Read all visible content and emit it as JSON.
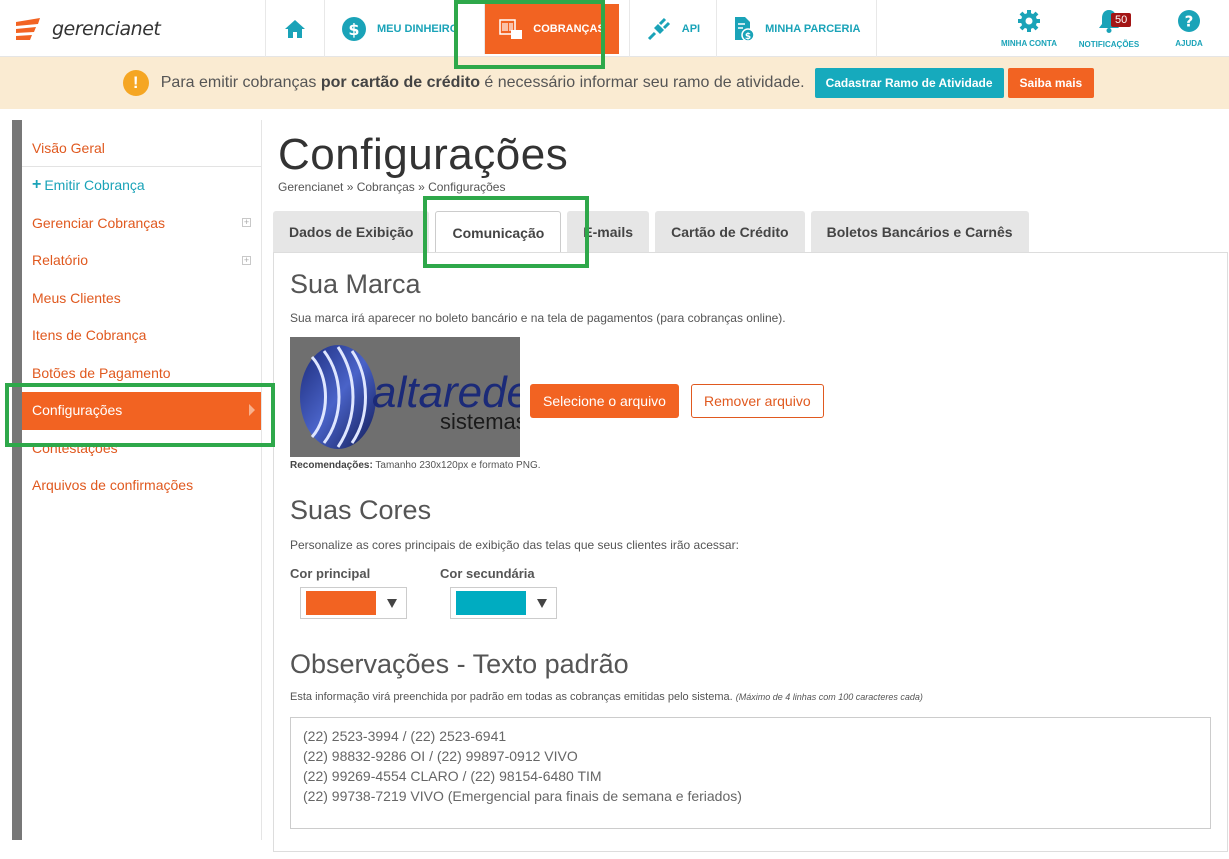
{
  "brand": {
    "name": "gerencianet"
  },
  "nav": {
    "items": [
      {
        "label": "",
        "icon": "home-icon"
      },
      {
        "label": "MEU DINHEIRO",
        "icon": "dollar-icon"
      },
      {
        "label": "COBRANÇAS",
        "icon": "billing-icon"
      },
      {
        "label": "API",
        "icon": "plug-icon"
      },
      {
        "label": "MINHA PARCERIA",
        "icon": "document-money-icon"
      }
    ],
    "right": {
      "account": "MINHA CONTA",
      "notifications": "NOTIFICAÇÕES",
      "notifications_count": "50",
      "help": "AJUDA"
    }
  },
  "alert": {
    "prefix": "Para emitir cobranças ",
    "bold": "por cartão de crédito",
    "suffix": " é necessário informar seu ramo de atividade.",
    "btn_primary": "Cadastrar Ramo de Atividade",
    "btn_secondary": "Saiba mais"
  },
  "sidebar": {
    "items": [
      {
        "label": "Visão Geral"
      },
      {
        "label": "Emitir Cobrança"
      },
      {
        "label": "Gerenciar Cobranças"
      },
      {
        "label": "Relatório"
      },
      {
        "label": "Meus Clientes"
      },
      {
        "label": "Itens de Cobrança"
      },
      {
        "label": "Botões de Pagamento"
      },
      {
        "label": "Configurações"
      },
      {
        "label": "Contestações"
      },
      {
        "label": "Arquivos de confirmações"
      }
    ]
  },
  "page": {
    "title": "Configurações",
    "breadcrumb": "Gerencianet » Cobranças » Configurações"
  },
  "tabs": [
    {
      "label": "Dados de Exibição"
    },
    {
      "label": "Comunicação"
    },
    {
      "label": "E-mails"
    },
    {
      "label": "Cartão de Crédito"
    },
    {
      "label": "Boletos Bancários e Carnês"
    }
  ],
  "brand_section": {
    "title": "Sua Marca",
    "desc": "Sua marca irá aparecer no boleto bancário e na tela de pagamentos (para cobranças online).",
    "logo_word": "altarede",
    "logo_sub": "sistemas",
    "btn_select": "Selecione o arquivo",
    "btn_remove": "Remover arquivo",
    "rec_label": "Recomendações:",
    "rec_text": " Tamanho 230x120px e formato PNG."
  },
  "colors_section": {
    "title": "Suas Cores",
    "desc": "Personalize as cores principais de exibição das telas que seus clientes irão acessar:",
    "primary_label": "Cor principal",
    "primary_color": "#f26322",
    "secondary_label": "Cor secundária",
    "secondary_color": "#00acc1"
  },
  "obs_section": {
    "title": "Observações - Texto padrão",
    "desc": "Esta informação virá preenchida por padrão em todas as cobranças emitidas pelo sistema.",
    "desc_small": "(Máximo de 4 linhas com 100 caracteres cada)",
    "text": "(22) 2523-3994 / (22) 2523-6941\n(22) 98832-9286 OI / (22) 99897-0912 VIVO\n(22) 99269-4554 CLARO / (22) 98154-6480 TIM\n(22) 99738-7219 VIVO (Emergencial para finais de semana e feriados)"
  }
}
